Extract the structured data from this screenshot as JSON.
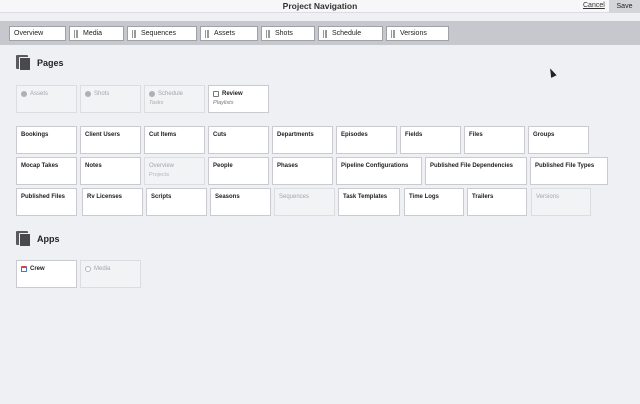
{
  "header": {
    "title": "Project Navigation",
    "cancel_label": "Cancel",
    "save_label": "Save"
  },
  "nav_tabs": [
    "Overview",
    "Media",
    "Sequences",
    "Assets",
    "Shots",
    "Schedule",
    "Versions"
  ],
  "pages_section": {
    "heading": "Pages",
    "top_cards": [
      {
        "label": "Assets",
        "sub": "",
        "state": "disabled"
      },
      {
        "label": "Shots",
        "sub": "",
        "state": "disabled"
      },
      {
        "label": "Schedule",
        "sub": "Tasks",
        "state": "disabled"
      },
      {
        "label": "Review",
        "sub": "Playlists",
        "state": "enabled"
      }
    ],
    "rows": [
      [
        {
          "label": "Bookings"
        },
        {
          "label": "Client Users"
        },
        {
          "label": "Cut Items"
        },
        {
          "label": "Cuts"
        },
        {
          "label": "Departments"
        },
        {
          "label": "Episodes"
        },
        {
          "label": "Fields"
        },
        {
          "label": "Files"
        },
        {
          "label": "Groups"
        }
      ],
      [
        {
          "label": "Mocap Takes"
        },
        {
          "label": "Notes"
        },
        {
          "label": "Overview",
          "sub": "Projects",
          "state": "disabled"
        },
        {
          "label": "People"
        },
        {
          "label": "Phases"
        },
        {
          "label": "Pipeline Configurations"
        },
        {
          "label": "Published File Dependencies"
        },
        {
          "label": "Published File Types"
        }
      ],
      [
        {
          "label": "Published Files"
        },
        {
          "label": "Rv Licenses"
        },
        {
          "label": "Scripts"
        },
        {
          "label": "Seasons"
        },
        {
          "label": "Sequences",
          "state": "disabled"
        },
        {
          "label": "Task Templates"
        },
        {
          "label": "Time Logs"
        },
        {
          "label": "Trailers"
        },
        {
          "label": "Versions",
          "state": "disabled"
        }
      ]
    ]
  },
  "apps_section": {
    "heading": "Apps",
    "cards": [
      {
        "label": "Crew",
        "icon": "calendar-icon",
        "state": "enabled"
      },
      {
        "label": "Media",
        "icon": "play-icon",
        "state": "disabled"
      }
    ]
  }
}
